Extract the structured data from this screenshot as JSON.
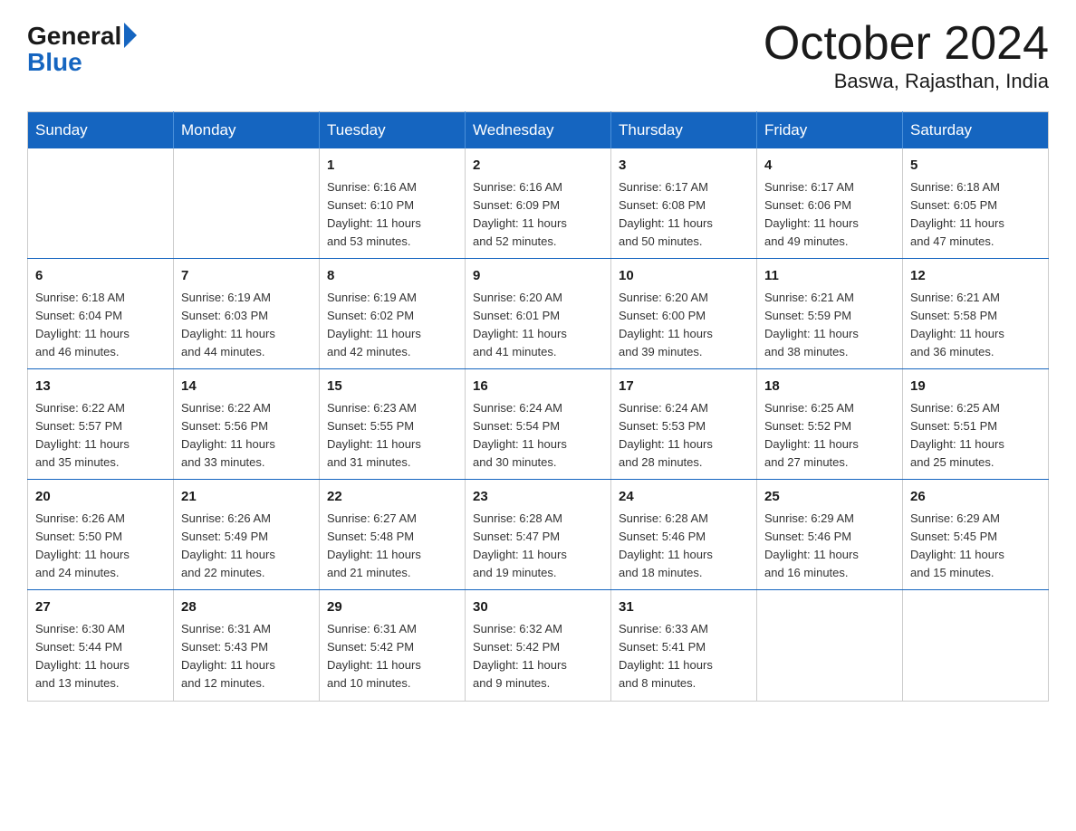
{
  "header": {
    "logo_general": "General",
    "logo_blue": "Blue",
    "month_title": "October 2024",
    "location": "Baswa, Rajasthan, India"
  },
  "days_of_week": [
    "Sunday",
    "Monday",
    "Tuesday",
    "Wednesday",
    "Thursday",
    "Friday",
    "Saturday"
  ],
  "weeks": [
    [
      {
        "day": "",
        "info": ""
      },
      {
        "day": "",
        "info": ""
      },
      {
        "day": "1",
        "info": "Sunrise: 6:16 AM\nSunset: 6:10 PM\nDaylight: 11 hours\nand 53 minutes."
      },
      {
        "day": "2",
        "info": "Sunrise: 6:16 AM\nSunset: 6:09 PM\nDaylight: 11 hours\nand 52 minutes."
      },
      {
        "day": "3",
        "info": "Sunrise: 6:17 AM\nSunset: 6:08 PM\nDaylight: 11 hours\nand 50 minutes."
      },
      {
        "day": "4",
        "info": "Sunrise: 6:17 AM\nSunset: 6:06 PM\nDaylight: 11 hours\nand 49 minutes."
      },
      {
        "day": "5",
        "info": "Sunrise: 6:18 AM\nSunset: 6:05 PM\nDaylight: 11 hours\nand 47 minutes."
      }
    ],
    [
      {
        "day": "6",
        "info": "Sunrise: 6:18 AM\nSunset: 6:04 PM\nDaylight: 11 hours\nand 46 minutes."
      },
      {
        "day": "7",
        "info": "Sunrise: 6:19 AM\nSunset: 6:03 PM\nDaylight: 11 hours\nand 44 minutes."
      },
      {
        "day": "8",
        "info": "Sunrise: 6:19 AM\nSunset: 6:02 PM\nDaylight: 11 hours\nand 42 minutes."
      },
      {
        "day": "9",
        "info": "Sunrise: 6:20 AM\nSunset: 6:01 PM\nDaylight: 11 hours\nand 41 minutes."
      },
      {
        "day": "10",
        "info": "Sunrise: 6:20 AM\nSunset: 6:00 PM\nDaylight: 11 hours\nand 39 minutes."
      },
      {
        "day": "11",
        "info": "Sunrise: 6:21 AM\nSunset: 5:59 PM\nDaylight: 11 hours\nand 38 minutes."
      },
      {
        "day": "12",
        "info": "Sunrise: 6:21 AM\nSunset: 5:58 PM\nDaylight: 11 hours\nand 36 minutes."
      }
    ],
    [
      {
        "day": "13",
        "info": "Sunrise: 6:22 AM\nSunset: 5:57 PM\nDaylight: 11 hours\nand 35 minutes."
      },
      {
        "day": "14",
        "info": "Sunrise: 6:22 AM\nSunset: 5:56 PM\nDaylight: 11 hours\nand 33 minutes."
      },
      {
        "day": "15",
        "info": "Sunrise: 6:23 AM\nSunset: 5:55 PM\nDaylight: 11 hours\nand 31 minutes."
      },
      {
        "day": "16",
        "info": "Sunrise: 6:24 AM\nSunset: 5:54 PM\nDaylight: 11 hours\nand 30 minutes."
      },
      {
        "day": "17",
        "info": "Sunrise: 6:24 AM\nSunset: 5:53 PM\nDaylight: 11 hours\nand 28 minutes."
      },
      {
        "day": "18",
        "info": "Sunrise: 6:25 AM\nSunset: 5:52 PM\nDaylight: 11 hours\nand 27 minutes."
      },
      {
        "day": "19",
        "info": "Sunrise: 6:25 AM\nSunset: 5:51 PM\nDaylight: 11 hours\nand 25 minutes."
      }
    ],
    [
      {
        "day": "20",
        "info": "Sunrise: 6:26 AM\nSunset: 5:50 PM\nDaylight: 11 hours\nand 24 minutes."
      },
      {
        "day": "21",
        "info": "Sunrise: 6:26 AM\nSunset: 5:49 PM\nDaylight: 11 hours\nand 22 minutes."
      },
      {
        "day": "22",
        "info": "Sunrise: 6:27 AM\nSunset: 5:48 PM\nDaylight: 11 hours\nand 21 minutes."
      },
      {
        "day": "23",
        "info": "Sunrise: 6:28 AM\nSunset: 5:47 PM\nDaylight: 11 hours\nand 19 minutes."
      },
      {
        "day": "24",
        "info": "Sunrise: 6:28 AM\nSunset: 5:46 PM\nDaylight: 11 hours\nand 18 minutes."
      },
      {
        "day": "25",
        "info": "Sunrise: 6:29 AM\nSunset: 5:46 PM\nDaylight: 11 hours\nand 16 minutes."
      },
      {
        "day": "26",
        "info": "Sunrise: 6:29 AM\nSunset: 5:45 PM\nDaylight: 11 hours\nand 15 minutes."
      }
    ],
    [
      {
        "day": "27",
        "info": "Sunrise: 6:30 AM\nSunset: 5:44 PM\nDaylight: 11 hours\nand 13 minutes."
      },
      {
        "day": "28",
        "info": "Sunrise: 6:31 AM\nSunset: 5:43 PM\nDaylight: 11 hours\nand 12 minutes."
      },
      {
        "day": "29",
        "info": "Sunrise: 6:31 AM\nSunset: 5:42 PM\nDaylight: 11 hours\nand 10 minutes."
      },
      {
        "day": "30",
        "info": "Sunrise: 6:32 AM\nSunset: 5:42 PM\nDaylight: 11 hours\nand 9 minutes."
      },
      {
        "day": "31",
        "info": "Sunrise: 6:33 AM\nSunset: 5:41 PM\nDaylight: 11 hours\nand 8 minutes."
      },
      {
        "day": "",
        "info": ""
      },
      {
        "day": "",
        "info": ""
      }
    ]
  ]
}
